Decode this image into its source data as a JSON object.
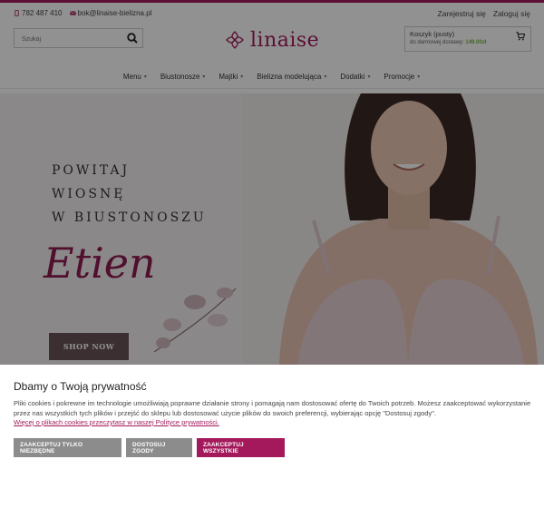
{
  "topbar": {
    "phone": "782 487 410",
    "email": "bok@linaise-bielizna.pl",
    "register": "Zarejestruj się",
    "login": "Zaloguj się"
  },
  "search": {
    "placeholder": "Szukaj"
  },
  "logo": {
    "text": "linaise"
  },
  "cart": {
    "title": "Koszyk (pusty)",
    "free_shipping_label": "do darmowej dostawy:",
    "free_shipping_value": "149.00zł"
  },
  "nav": {
    "items": [
      {
        "label": "Menu"
      },
      {
        "label": "Biustonosze"
      },
      {
        "label": "Majtki"
      },
      {
        "label": "Bielizna modelująca"
      },
      {
        "label": "Dodatki"
      },
      {
        "label": "Promocje"
      }
    ]
  },
  "hero": {
    "line1": "POWITAJ",
    "line2": "WIOSNĘ",
    "line3": "W BIUSTONOSZU",
    "script": "Etien",
    "button": "SHOP NOW"
  },
  "cookie": {
    "title": "Dbamy o Twoją prywatność",
    "text": "Pliki cookies i pokrewne im technologie umożliwiają poprawne działanie strony i pomagają nam dostosować ofertę do Twoich potrzeb. Możesz zaakceptować wykorzystanie przez nas wszystkich tych plików i przejść do sklepu lub dostosować użycie plików do swoich preferencji, wybierając opcję \"Dostosuj zgody\".",
    "link": "Więcej o plikach cookies przeczytasz w naszej Polityce prywatności.",
    "btn_necessary": "ZAAKCEPTUJ TYLKO NIEZBĘDNE",
    "btn_customize": "DOSTOSUJ ZGODY",
    "btn_accept_all": "ZAAKCEPTUJ WSZYSTKIE"
  },
  "colors": {
    "brand": "#a3195b",
    "grey_button": "#8c8c8c",
    "shipping_value": "#7cb342"
  }
}
